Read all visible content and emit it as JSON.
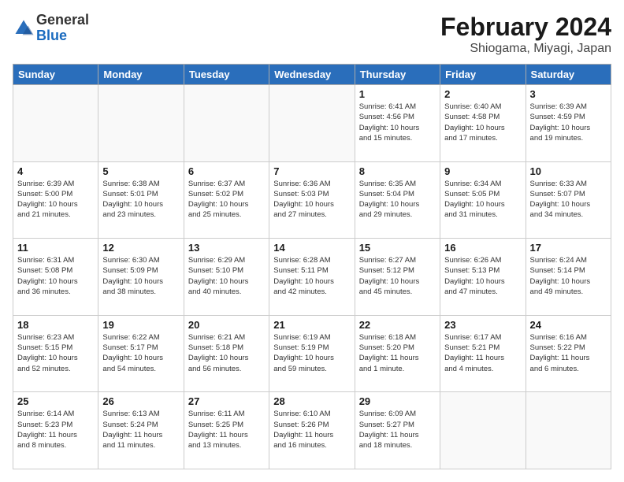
{
  "header": {
    "logo": {
      "general": "General",
      "blue": "Blue"
    },
    "title": "February 2024",
    "subtitle": "Shiogama, Miyagi, Japan"
  },
  "weekdays": [
    "Sunday",
    "Monday",
    "Tuesday",
    "Wednesday",
    "Thursday",
    "Friday",
    "Saturday"
  ],
  "weeks": [
    [
      {
        "day": "",
        "info": ""
      },
      {
        "day": "",
        "info": ""
      },
      {
        "day": "",
        "info": ""
      },
      {
        "day": "",
        "info": ""
      },
      {
        "day": "1",
        "info": "Sunrise: 6:41 AM\nSunset: 4:56 PM\nDaylight: 10 hours\nand 15 minutes."
      },
      {
        "day": "2",
        "info": "Sunrise: 6:40 AM\nSunset: 4:58 PM\nDaylight: 10 hours\nand 17 minutes."
      },
      {
        "day": "3",
        "info": "Sunrise: 6:39 AM\nSunset: 4:59 PM\nDaylight: 10 hours\nand 19 minutes."
      }
    ],
    [
      {
        "day": "4",
        "info": "Sunrise: 6:39 AM\nSunset: 5:00 PM\nDaylight: 10 hours\nand 21 minutes."
      },
      {
        "day": "5",
        "info": "Sunrise: 6:38 AM\nSunset: 5:01 PM\nDaylight: 10 hours\nand 23 minutes."
      },
      {
        "day": "6",
        "info": "Sunrise: 6:37 AM\nSunset: 5:02 PM\nDaylight: 10 hours\nand 25 minutes."
      },
      {
        "day": "7",
        "info": "Sunrise: 6:36 AM\nSunset: 5:03 PM\nDaylight: 10 hours\nand 27 minutes."
      },
      {
        "day": "8",
        "info": "Sunrise: 6:35 AM\nSunset: 5:04 PM\nDaylight: 10 hours\nand 29 minutes."
      },
      {
        "day": "9",
        "info": "Sunrise: 6:34 AM\nSunset: 5:05 PM\nDaylight: 10 hours\nand 31 minutes."
      },
      {
        "day": "10",
        "info": "Sunrise: 6:33 AM\nSunset: 5:07 PM\nDaylight: 10 hours\nand 34 minutes."
      }
    ],
    [
      {
        "day": "11",
        "info": "Sunrise: 6:31 AM\nSunset: 5:08 PM\nDaylight: 10 hours\nand 36 minutes."
      },
      {
        "day": "12",
        "info": "Sunrise: 6:30 AM\nSunset: 5:09 PM\nDaylight: 10 hours\nand 38 minutes."
      },
      {
        "day": "13",
        "info": "Sunrise: 6:29 AM\nSunset: 5:10 PM\nDaylight: 10 hours\nand 40 minutes."
      },
      {
        "day": "14",
        "info": "Sunrise: 6:28 AM\nSunset: 5:11 PM\nDaylight: 10 hours\nand 42 minutes."
      },
      {
        "day": "15",
        "info": "Sunrise: 6:27 AM\nSunset: 5:12 PM\nDaylight: 10 hours\nand 45 minutes."
      },
      {
        "day": "16",
        "info": "Sunrise: 6:26 AM\nSunset: 5:13 PM\nDaylight: 10 hours\nand 47 minutes."
      },
      {
        "day": "17",
        "info": "Sunrise: 6:24 AM\nSunset: 5:14 PM\nDaylight: 10 hours\nand 49 minutes."
      }
    ],
    [
      {
        "day": "18",
        "info": "Sunrise: 6:23 AM\nSunset: 5:15 PM\nDaylight: 10 hours\nand 52 minutes."
      },
      {
        "day": "19",
        "info": "Sunrise: 6:22 AM\nSunset: 5:17 PM\nDaylight: 10 hours\nand 54 minutes."
      },
      {
        "day": "20",
        "info": "Sunrise: 6:21 AM\nSunset: 5:18 PM\nDaylight: 10 hours\nand 56 minutes."
      },
      {
        "day": "21",
        "info": "Sunrise: 6:19 AM\nSunset: 5:19 PM\nDaylight: 10 hours\nand 59 minutes."
      },
      {
        "day": "22",
        "info": "Sunrise: 6:18 AM\nSunset: 5:20 PM\nDaylight: 11 hours\nand 1 minute."
      },
      {
        "day": "23",
        "info": "Sunrise: 6:17 AM\nSunset: 5:21 PM\nDaylight: 11 hours\nand 4 minutes."
      },
      {
        "day": "24",
        "info": "Sunrise: 6:16 AM\nSunset: 5:22 PM\nDaylight: 11 hours\nand 6 minutes."
      }
    ],
    [
      {
        "day": "25",
        "info": "Sunrise: 6:14 AM\nSunset: 5:23 PM\nDaylight: 11 hours\nand 8 minutes."
      },
      {
        "day": "26",
        "info": "Sunrise: 6:13 AM\nSunset: 5:24 PM\nDaylight: 11 hours\nand 11 minutes."
      },
      {
        "day": "27",
        "info": "Sunrise: 6:11 AM\nSunset: 5:25 PM\nDaylight: 11 hours\nand 13 minutes."
      },
      {
        "day": "28",
        "info": "Sunrise: 6:10 AM\nSunset: 5:26 PM\nDaylight: 11 hours\nand 16 minutes."
      },
      {
        "day": "29",
        "info": "Sunrise: 6:09 AM\nSunset: 5:27 PM\nDaylight: 11 hours\nand 18 minutes."
      },
      {
        "day": "",
        "info": ""
      },
      {
        "day": "",
        "info": ""
      }
    ]
  ]
}
